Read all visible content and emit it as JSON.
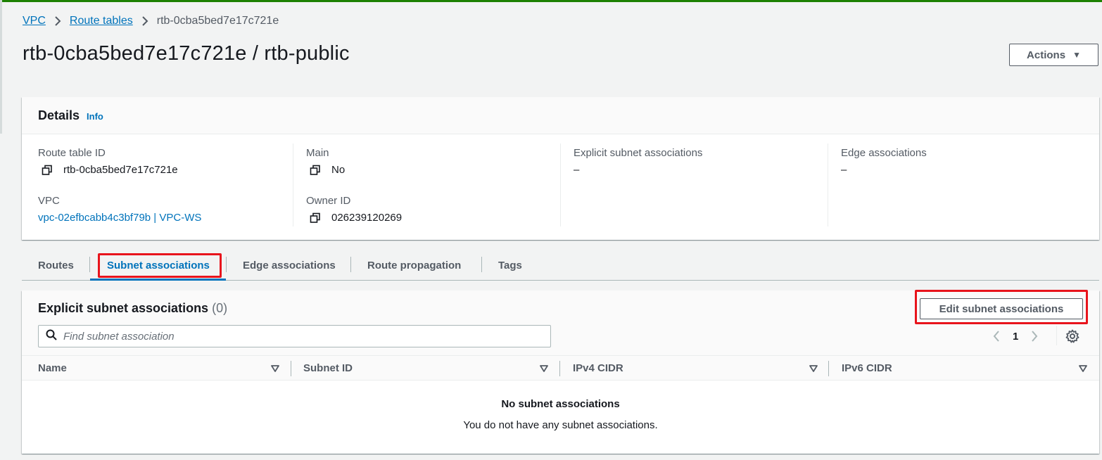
{
  "breadcrumb": {
    "items": [
      {
        "label": "VPC"
      },
      {
        "label": "Route tables"
      }
    ],
    "current": "rtb-0cba5bed7e17c721e"
  },
  "header": {
    "title": "rtb-0cba5bed7e17c721e / rtb-public",
    "actions_label": "Actions"
  },
  "details": {
    "title": "Details",
    "info_label": "Info",
    "route_table_id_label": "Route table ID",
    "route_table_id_value": "rtb-0cba5bed7e17c721e",
    "vpc_label": "VPC",
    "vpc_value": "vpc-02efbcabb4c3bf79b | VPC-WS",
    "main_label": "Main",
    "main_value": "No",
    "owner_id_label": "Owner ID",
    "owner_id_value": "026239120269",
    "explicit_label": "Explicit subnet associations",
    "explicit_value": "–",
    "edge_label": "Edge associations",
    "edge_value": "–"
  },
  "tabs": [
    {
      "label": "Routes"
    },
    {
      "label": "Subnet associations",
      "active": true
    },
    {
      "label": "Edge associations"
    },
    {
      "label": "Route propagation"
    },
    {
      "label": "Tags"
    }
  ],
  "associations": {
    "title": "Explicit subnet associations",
    "count": "(0)",
    "edit_button": "Edit subnet associations",
    "search_placeholder": "Find subnet association",
    "page": "1",
    "columns": [
      "Name",
      "Subnet ID",
      "IPv4 CIDR",
      "IPv6 CIDR"
    ],
    "empty_title": "No subnet associations",
    "empty_desc": "You do not have any subnet associations."
  },
  "colors": {
    "link": "#0073bb",
    "highlight": "#e8141c",
    "success_bar": "#1d8102"
  }
}
